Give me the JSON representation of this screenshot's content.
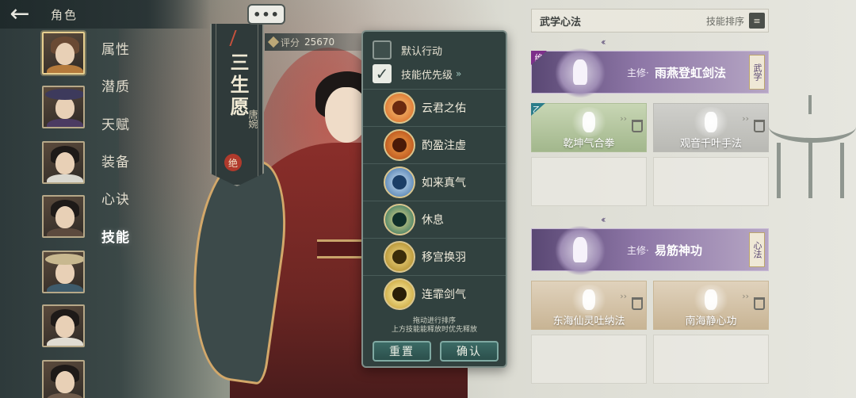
{
  "topbar": {
    "back_icon": "back-arrow-icon",
    "title": "角色"
  },
  "nav": {
    "items": [
      "属性",
      "潜质",
      "天赋",
      "装备",
      "心诀",
      "技能"
    ],
    "active_index": 5
  },
  "portraits": {
    "count": 7,
    "selected_index": 0
  },
  "character": {
    "name": "三生愿",
    "subname": "唐婉",
    "seal": "绝",
    "score_label": "评分",
    "score_value": "25670"
  },
  "more_button": {
    "label": "•••"
  },
  "popup": {
    "default_action": {
      "label": "默认行动",
      "checked": false
    },
    "skill_priority": {
      "label": "技能优先级",
      "checked": true,
      "check_glyph": "✓",
      "arrow": "»"
    },
    "skills": [
      {
        "name": "云君之佑",
        "icon": "swirl-icon",
        "color": "#d9621e"
      },
      {
        "name": "酌盈注虚",
        "icon": "flame-face-icon",
        "color": "#b04312"
      },
      {
        "name": "如来真气",
        "icon": "wave-icon",
        "color": "#3c6fa8"
      },
      {
        "name": "休息",
        "icon": "meditation-icon",
        "color": "#1f6b5e"
      },
      {
        "name": "移宫换羽",
        "icon": "feather-icon",
        "color": "#a6811e"
      },
      {
        "name": "连霏剑气",
        "icon": "sword-burst-icon",
        "color": "#c29a28"
      }
    ],
    "hint_line1": "拖动进行排序",
    "hint_line2": "上方技能能释放时优先释放",
    "reset_label": "重置",
    "confirm_label": "确认"
  },
  "right_panel": {
    "title": "武学心法",
    "sort_label": "技能排序",
    "sort_icon": "sort-icon",
    "sort_glyph": "≡",
    "main1": {
      "prefix": "主修·",
      "name": "雨燕登虹剑法",
      "tag": "武学",
      "corner": "绝"
    },
    "row1": [
      {
        "name": "乾坤气合拳",
        "style": "green",
        "corner": "乙"
      },
      {
        "name": "观音千叶手法",
        "style": "gray",
        "corner": ""
      }
    ],
    "main2": {
      "prefix": "主修·",
      "name": "易筋神功",
      "tag": "心法",
      "corner": ""
    },
    "row2": [
      {
        "name": "东海仙灵吐纳法",
        "style": "tan",
        "corner": ""
      },
      {
        "name": "南海静心功",
        "style": "tan",
        "corner": ""
      }
    ]
  },
  "colors": {
    "accent_purple": "#8d76a6",
    "popup_bg": "#31413f",
    "button_teal": "#3c6b66"
  }
}
